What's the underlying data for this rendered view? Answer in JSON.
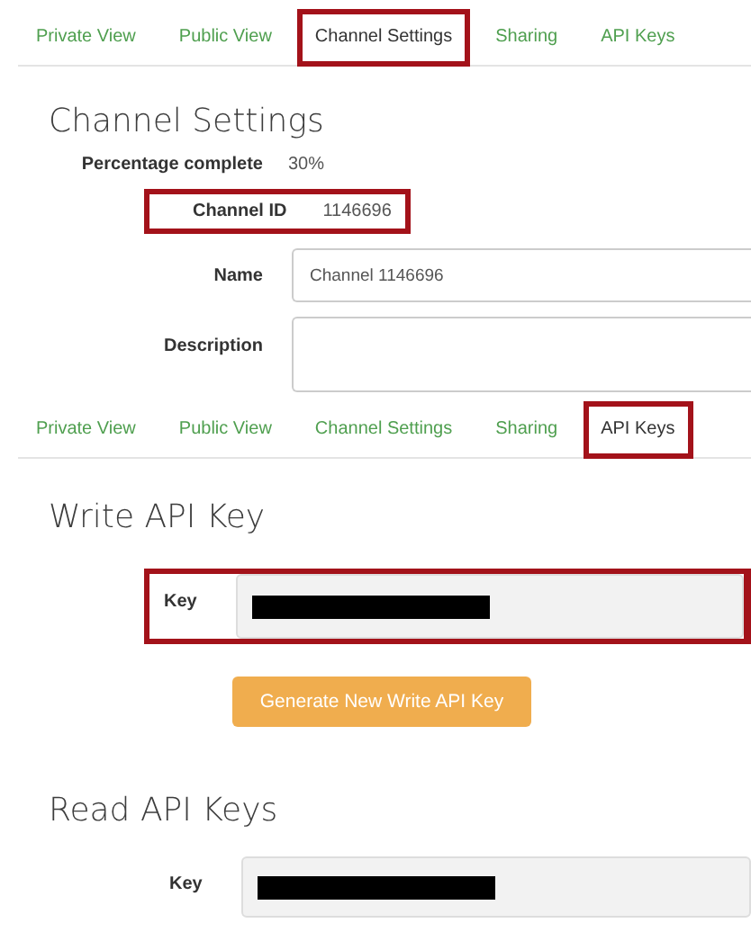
{
  "settings_panel": {
    "tabs": [
      {
        "label": "Private View",
        "selected": false,
        "highlighted": false
      },
      {
        "label": "Public View",
        "selected": false,
        "highlighted": false
      },
      {
        "label": "Channel Settings",
        "selected": true,
        "highlighted": true
      },
      {
        "label": "Sharing",
        "selected": false,
        "highlighted": false
      },
      {
        "label": "API Keys",
        "selected": false,
        "highlighted": false
      }
    ],
    "heading": "Channel Settings",
    "fields": [
      {
        "kind": "info",
        "label": "Percentage complete",
        "value": "30%"
      },
      {
        "kind": "info",
        "label": "Channel ID",
        "value": "1146696",
        "highlighted": true
      },
      {
        "kind": "input",
        "label": "Name",
        "value": "Channel 1146696"
      },
      {
        "kind": "textarea",
        "label": "Description"
      }
    ]
  },
  "api_keys_panel": {
    "tabs": [
      {
        "label": "Private View",
        "selected": false,
        "highlighted": false
      },
      {
        "label": "Public View",
        "selected": false,
        "highlighted": false
      },
      {
        "label": "Channel Settings",
        "selected": false,
        "highlighted": false
      },
      {
        "label": "Sharing",
        "selected": false,
        "highlighted": false
      },
      {
        "label": "API Keys",
        "selected": true,
        "highlighted": true
      }
    ],
    "write_section": {
      "heading": "Write API Key",
      "key_label": "Key",
      "highlighted": true
    },
    "generate_button": "Generate New Write API Key",
    "read_section": {
      "heading": "Read API Keys",
      "key_label": "Key",
      "highlighted": false
    }
  }
}
